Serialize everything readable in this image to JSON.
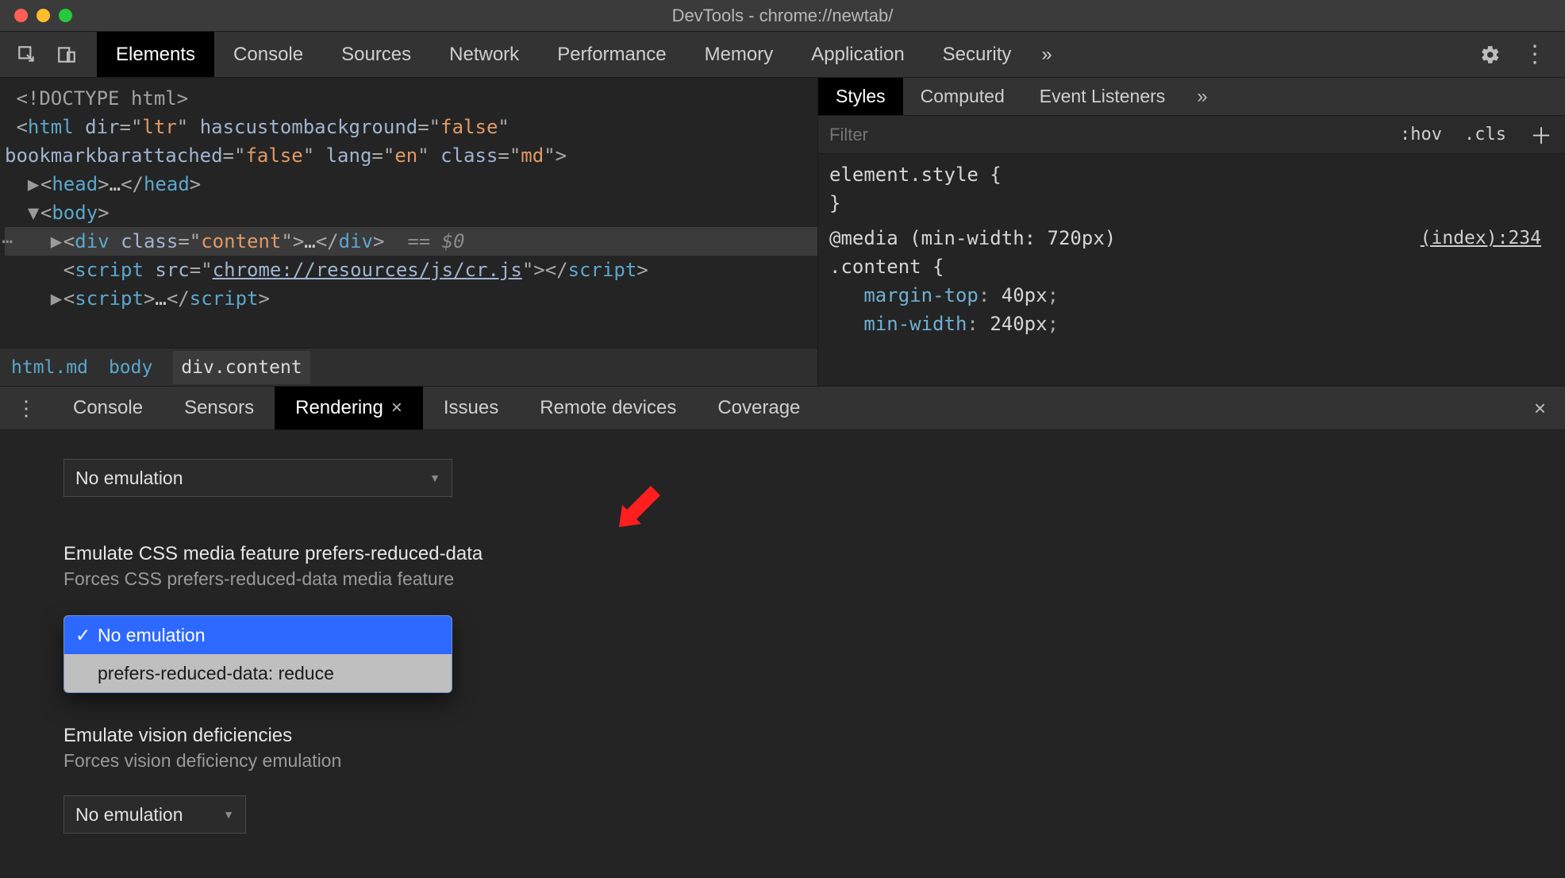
{
  "window": {
    "title": "DevTools - chrome://newtab/"
  },
  "toolbar": {
    "tabs": [
      "Elements",
      "Console",
      "Sources",
      "Network",
      "Performance",
      "Memory",
      "Application",
      "Security"
    ],
    "active_index": 0
  },
  "dom": {
    "lines": [
      {
        "indent": 0,
        "raw_doctype": "<!DOCTYPE html>"
      },
      {
        "indent": 0,
        "open_html": true
      },
      {
        "indent": 0,
        "open_html2": true
      },
      {
        "indent": 1,
        "expander": "▶",
        "collapsed_head": true
      },
      {
        "indent": 1,
        "expander": "▼",
        "body_open": true
      },
      {
        "indent": 2,
        "expander": "▶",
        "selected_content": true
      },
      {
        "indent": 2,
        "script_cr": true
      },
      {
        "indent": 2,
        "expander": "▶",
        "collapsed_script": true
      }
    ],
    "html_attrs": {
      "dir": "ltr",
      "hascustombackground": "false",
      "bookmarkbarattached": "false",
      "lang": "en",
      "class": "md"
    },
    "content_class": "content",
    "script_src": "chrome://resources/js/cr.js",
    "eq0": "== $0"
  },
  "breadcrumb": [
    "html.md",
    "body",
    "div.content"
  ],
  "styles": {
    "tabs": [
      "Styles",
      "Computed",
      "Event Listeners"
    ],
    "active_index": 0,
    "filter_placeholder": "Filter",
    "toggles": {
      "hov": ":hov",
      "cls": ".cls"
    },
    "element_style": "element.style {",
    "element_style_close": "}",
    "media": "@media (min-width: 720px)",
    "selector": ".content {",
    "src": "(index):234",
    "rules": [
      {
        "prop": "margin-top",
        "val": "40px"
      },
      {
        "prop": "min-width",
        "val": "240px"
      }
    ]
  },
  "drawer": {
    "tabs": [
      "Console",
      "Sensors",
      "Rendering",
      "Issues",
      "Remote devices",
      "Coverage"
    ],
    "active_index": 2
  },
  "rendering": {
    "top_select": "No emulation",
    "section1": {
      "heading": "Emulate CSS media feature prefers-reduced-data",
      "desc": "Forces CSS prefers-reduced-data media feature",
      "options": [
        "No emulation",
        "prefers-reduced-data: reduce"
      ],
      "selected_index": 0
    },
    "section2": {
      "heading": "Emulate vision deficiencies",
      "desc": "Forces vision deficiency emulation",
      "select": "No emulation"
    }
  },
  "colors": {
    "arrow": "#ff1f1f"
  }
}
